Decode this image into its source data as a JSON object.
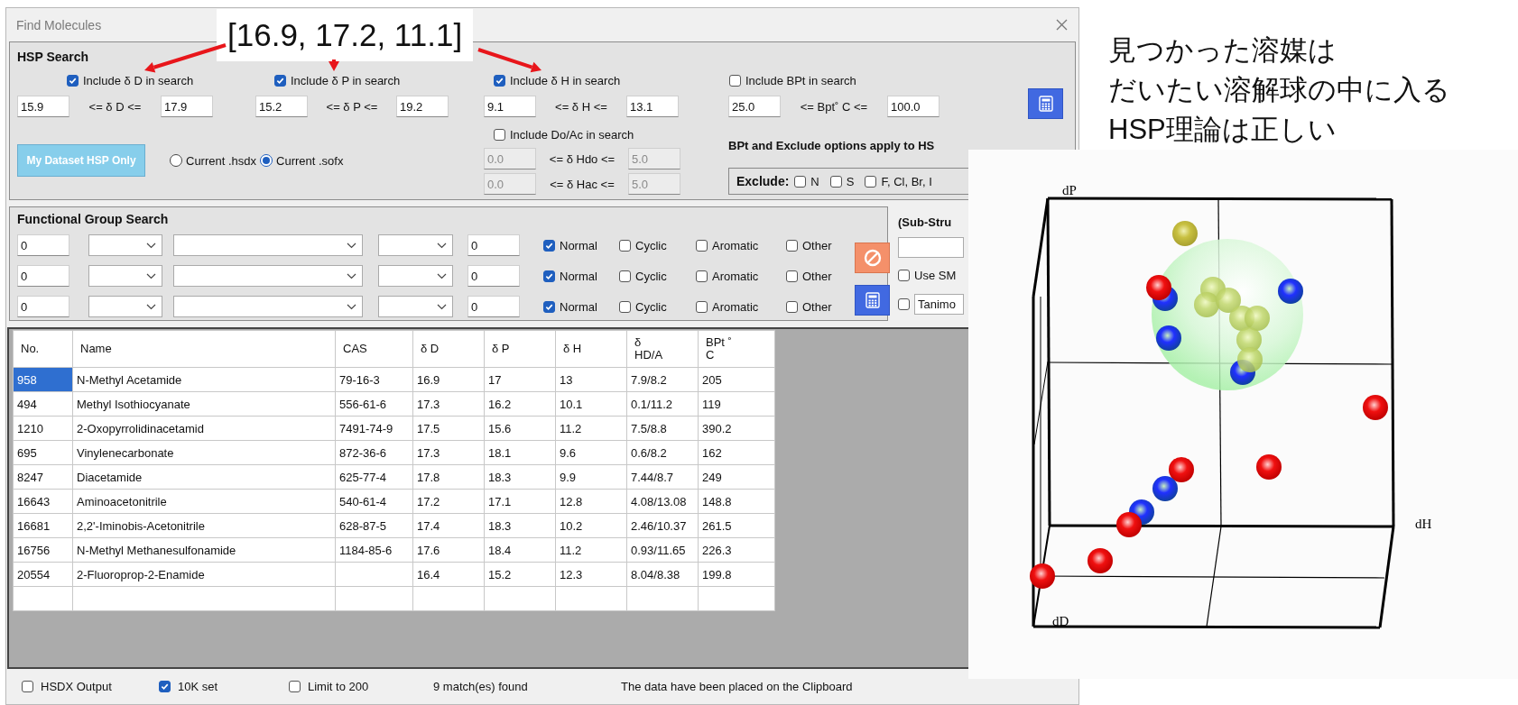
{
  "window": {
    "title": "Find Molecules"
  },
  "hsp_search": {
    "title": "HSP Search",
    "parameters": [
      {
        "include_label": "Include δ D in search",
        "checked": true,
        "min": "15.9",
        "relation": "<= δ D <=",
        "max": "17.9"
      },
      {
        "include_label": "Include δ P in search",
        "checked": true,
        "min": "15.2",
        "relation": "<= δ P <=",
        "max": "19.2"
      },
      {
        "include_label": "Include δ H in search",
        "checked": true,
        "min": "9.1",
        "relation": "<= δ H <=",
        "max": "13.1"
      },
      {
        "include_label": "Include BPt in search",
        "checked": false,
        "min": "25.0",
        "relation": "<= Bpt˚  C  <=",
        "max": "100.0"
      }
    ],
    "donor_acceptor": {
      "include_label": "Include Do/Ac in search",
      "checked": false,
      "rows": [
        {
          "min": "0.0",
          "relation": "<= δ Hdo <=",
          "max": "5.0",
          "disabled": true
        },
        {
          "min": "0.0",
          "relation": "<= δ Hac <=",
          "max": "5.0",
          "disabled": true
        }
      ]
    },
    "dataset_button": "My Dataset HSP Only",
    "sources": [
      {
        "label": "Current .hsdx",
        "selected": false
      },
      {
        "label": "Current .sofx",
        "selected": true
      }
    ],
    "note": "BPt and Exclude options apply to HS",
    "exclude": {
      "label": "Exclude:",
      "items": [
        {
          "label": "N",
          "checked": false
        },
        {
          "label": "S",
          "checked": false
        },
        {
          "label": "F, Cl, Br, I",
          "checked": false
        }
      ]
    }
  },
  "functional_group_search": {
    "title": "Functional Group Search",
    "rows": [
      {
        "count": "0",
        "count_2": "0",
        "types": [
          {
            "label": "Normal",
            "checked": true
          },
          {
            "label": "Cyclic",
            "checked": false
          },
          {
            "label": "Aromatic",
            "checked": false
          },
          {
            "label": "Other",
            "checked": false
          }
        ]
      },
      {
        "count": "0",
        "count_2": "0",
        "types": [
          {
            "label": "Normal",
            "checked": true
          },
          {
            "label": "Cyclic",
            "checked": false
          },
          {
            "label": "Aromatic",
            "checked": false
          },
          {
            "label": "Other",
            "checked": false
          }
        ]
      },
      {
        "count": "0",
        "count_2": "0",
        "types": [
          {
            "label": "Normal",
            "checked": true
          },
          {
            "label": "Cyclic",
            "checked": false
          },
          {
            "label": "Aromatic",
            "checked": false
          },
          {
            "label": "Other",
            "checked": false
          }
        ]
      }
    ]
  },
  "sub_structure": {
    "title": "(Sub-Stru",
    "use_smiles": {
      "label": "Use SM",
      "checked": false
    },
    "similarity": {
      "checked": false,
      "value": "Tanimo"
    }
  },
  "table": {
    "columns": [
      "No.",
      "Name",
      "CAS",
      "δ D",
      "δ P",
      "δ H",
      "δ\nHD/A",
      "BPt ˚\nC"
    ],
    "rows": [
      {
        "selected": true,
        "cells": [
          "958",
          "N-Methyl Acetamide",
          "79-16-3",
          "16.9",
          "17",
          "13",
          "7.9/8.2",
          "205"
        ]
      },
      {
        "selected": false,
        "cells": [
          "494",
          "Methyl Isothiocyanate",
          "556-61-6",
          "17.3",
          "16.2",
          "10.1",
          "0.1/11.2",
          "119"
        ]
      },
      {
        "selected": false,
        "cells": [
          "1210",
          "2-Oxopyrrolidinacetamid",
          "7491-74-9",
          "17.5",
          "15.6",
          "11.2",
          "7.5/8.8",
          "390.2"
        ]
      },
      {
        "selected": false,
        "cells": [
          "695",
          "Vinylenecarbonate",
          "872-36-6",
          "17.3",
          "18.1",
          "9.6",
          "0.6/8.2",
          "162"
        ]
      },
      {
        "selected": false,
        "cells": [
          "8247",
          "Diacetamide",
          "625-77-4",
          "17.8",
          "18.3",
          "9.9",
          "7.44/8.7",
          "249"
        ]
      },
      {
        "selected": false,
        "cells": [
          "16643",
          "Aminoacetonitrile",
          "540-61-4",
          "17.2",
          "17.1",
          "12.8",
          "4.08/13.08",
          "148.8"
        ]
      },
      {
        "selected": false,
        "cells": [
          "16681",
          "2,2'-Iminobis-Acetonitrile",
          "628-87-5",
          "17.4",
          "18.3",
          "10.2",
          "2.46/10.37",
          "261.5"
        ]
      },
      {
        "selected": false,
        "cells": [
          "16756",
          "N-Methyl Methanesulfonamide",
          "1184-85-6",
          "17.6",
          "18.4",
          "11.2",
          "0.93/11.65",
          "226.3"
        ]
      },
      {
        "selected": false,
        "cells": [
          "20554",
          "2-Fluoroprop-2-Enamide",
          "",
          "16.4",
          "15.2",
          "12.3",
          "8.04/8.38",
          "199.8"
        ]
      }
    ]
  },
  "status_bar": {
    "options": [
      {
        "label": "HSDX Output",
        "checked": false
      },
      {
        "label": "10K set",
        "checked": true
      },
      {
        "label": "Limit to 200",
        "checked": false
      }
    ],
    "match_count": "9 match(es) found",
    "message": "The data have been placed on the Clipboard"
  },
  "callout": {
    "text": "[16.9, 17.2, 11.1]"
  },
  "annotation": {
    "lines": [
      "見つかった溶媒は",
      "だいたい溶解球の中に入る",
      "HSP理論は正しい"
    ]
  },
  "plot": {
    "axis_labels": [
      "dP",
      "dH",
      "dD"
    ]
  }
}
